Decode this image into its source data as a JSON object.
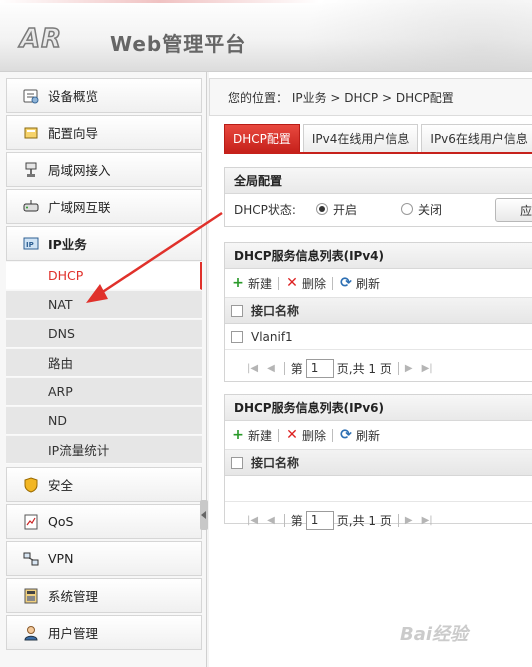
{
  "header": {
    "logo": "AR",
    "title": "Web管理平台"
  },
  "sidebar": {
    "items": [
      {
        "label": "设备概览",
        "icon": "device-overview-icon"
      },
      {
        "label": "配置向导",
        "icon": "wizard-icon"
      },
      {
        "label": "局域网接入",
        "icon": "lan-icon"
      },
      {
        "label": "广域网互联",
        "icon": "wan-icon"
      },
      {
        "label": "IP业务",
        "icon": "ip-service-icon"
      },
      {
        "label": "安全",
        "icon": "shield-icon"
      },
      {
        "label": "QoS",
        "icon": "qos-icon"
      },
      {
        "label": "VPN",
        "icon": "vpn-icon"
      },
      {
        "label": "系统管理",
        "icon": "system-icon"
      },
      {
        "label": "用户管理",
        "icon": "user-icon"
      }
    ],
    "ip_sub": [
      "DHCP",
      "NAT",
      "DNS",
      "路由",
      "ARP",
      "ND",
      "IP流量统计"
    ]
  },
  "breadcrumb": "您的位置： IP业务 > DHCP > DHCP配置",
  "tabs": [
    "DHCP配置",
    "IPv4在线用户信息",
    "IPv6在线用户信息"
  ],
  "global": {
    "title": "全局配置",
    "status_label": "DHCP状态:",
    "on": "开启",
    "off": "关闭",
    "apply": "应"
  },
  "ipv4": {
    "title": "DHCP服务信息列表(IPv4)",
    "toolbar": {
      "new": "新建",
      "delete": "删除",
      "refresh": "刷新"
    },
    "column": "接口名称",
    "rows": [
      "Vlanif1"
    ],
    "pager": {
      "page_prefix": "第",
      "page": "1",
      "page_suffix": "页,共 1 页"
    }
  },
  "ipv6": {
    "title": "DHCP服务信息列表(IPv6)",
    "toolbar": {
      "new": "新建",
      "delete": "删除",
      "refresh": "刷新"
    },
    "column": "接口名称",
    "pager": {
      "page_prefix": "第",
      "page": "1",
      "page_suffix": "页,共 1 页"
    }
  },
  "watermark": "Bai经验",
  "colors": {
    "accent": "#c6211b",
    "active_sub_text": "#e0312b",
    "arrow": "#e0312b"
  }
}
